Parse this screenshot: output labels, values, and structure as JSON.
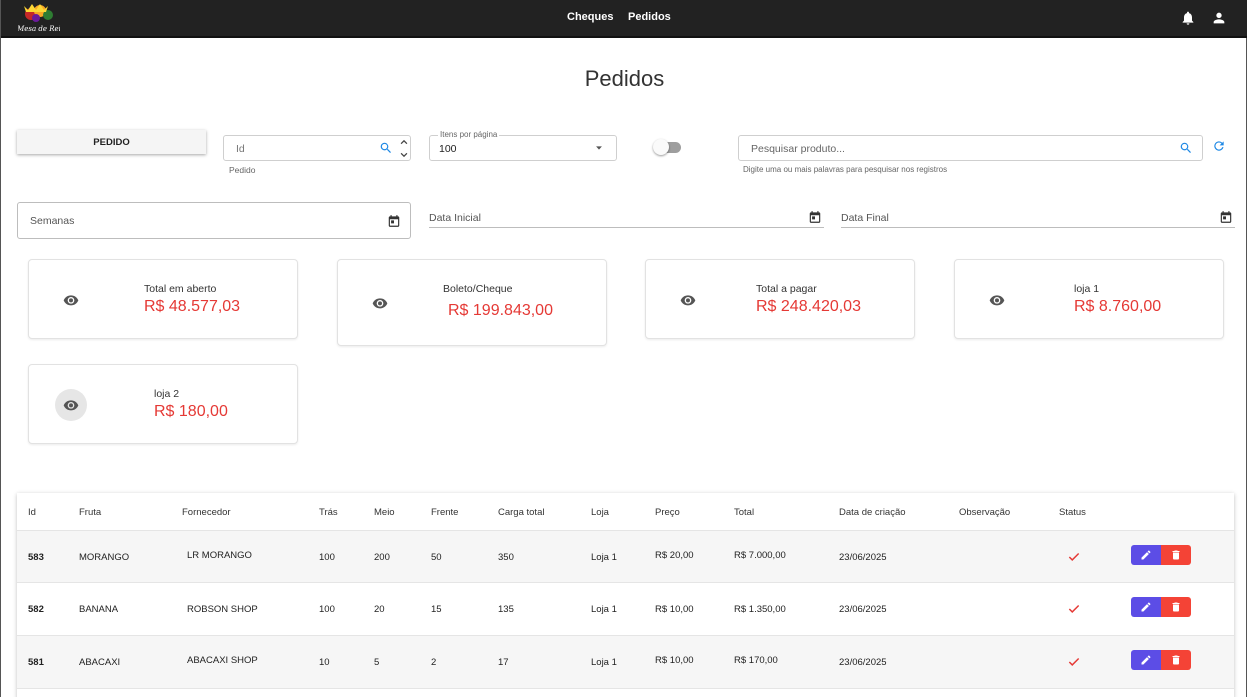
{
  "topbar": {
    "logo_text": "Mesa de Rei",
    "nav": [
      "Cheques",
      "Pedidos"
    ]
  },
  "page": {
    "title": "Pedidos"
  },
  "controls": {
    "pedido_button": "PEDIDO",
    "id_field": {
      "placeholder": "Id",
      "hint": "Pedido"
    },
    "items_per_page": {
      "label": "Itens por página",
      "value": "100"
    },
    "search": {
      "placeholder": "Pesquisar produto...",
      "hint": "Digite uma ou mais palavras para pesquisar nos registros"
    },
    "semanas": {
      "placeholder": "Semanas"
    },
    "data_inicial": {
      "placeholder": "Data Inicial"
    },
    "data_final": {
      "placeholder": "Data Final"
    }
  },
  "cards": [
    {
      "label": "Total em aberto",
      "value": "R$ 48.577,03"
    },
    {
      "label": "Boleto/Cheque",
      "value": "R$ 199.843,00"
    },
    {
      "label": "Total a pagar",
      "value": "R$ 248.420,03"
    },
    {
      "label": "loja 1",
      "value": "R$ 8.760,00"
    },
    {
      "label": "loja 2",
      "value": "R$ 180,00"
    }
  ],
  "table": {
    "headers": [
      "Id",
      "Fruta",
      "Fornecedor",
      "Trás",
      "Meio",
      "Frente",
      "Carga total",
      "Loja",
      "Preço",
      "Total",
      "Data de criação",
      "Observação",
      "Status"
    ],
    "rows": [
      {
        "id": "583",
        "fruta": "MORANGO",
        "fornecedor": "LR MORANGO",
        "tras": "100",
        "meio": "200",
        "frente": "50",
        "carga": "350",
        "loja": "Loja 1",
        "preco": "R$ 20,00",
        "total": "R$ 7.000,00",
        "data": "23/06/2025",
        "obs": ""
      },
      {
        "id": "582",
        "fruta": "BANANA",
        "fornecedor": "ROBSON SHOP",
        "tras": "100",
        "meio": "20",
        "frente": "15",
        "carga": "135",
        "loja": "Loja 1",
        "preco": "R$ 10,00",
        "total": "R$ 1.350,00",
        "data": "23/06/2025",
        "obs": ""
      },
      {
        "id": "581",
        "fruta": "ABACAXI",
        "fornecedor": "ABACAXI SHOP",
        "tras": "10",
        "meio": "5",
        "frente": "2",
        "carga": "17",
        "loja": "Loja 1",
        "preco": "R$ 10,00",
        "total": "R$ 170,00",
        "data": "23/06/2025",
        "obs": ""
      }
    ]
  },
  "colors": {
    "topbar": "#222222",
    "accent_blue": "#1e88e5",
    "money_red": "#e53935",
    "edit_purple": "#5c4de6",
    "delete_red": "#f44336"
  }
}
